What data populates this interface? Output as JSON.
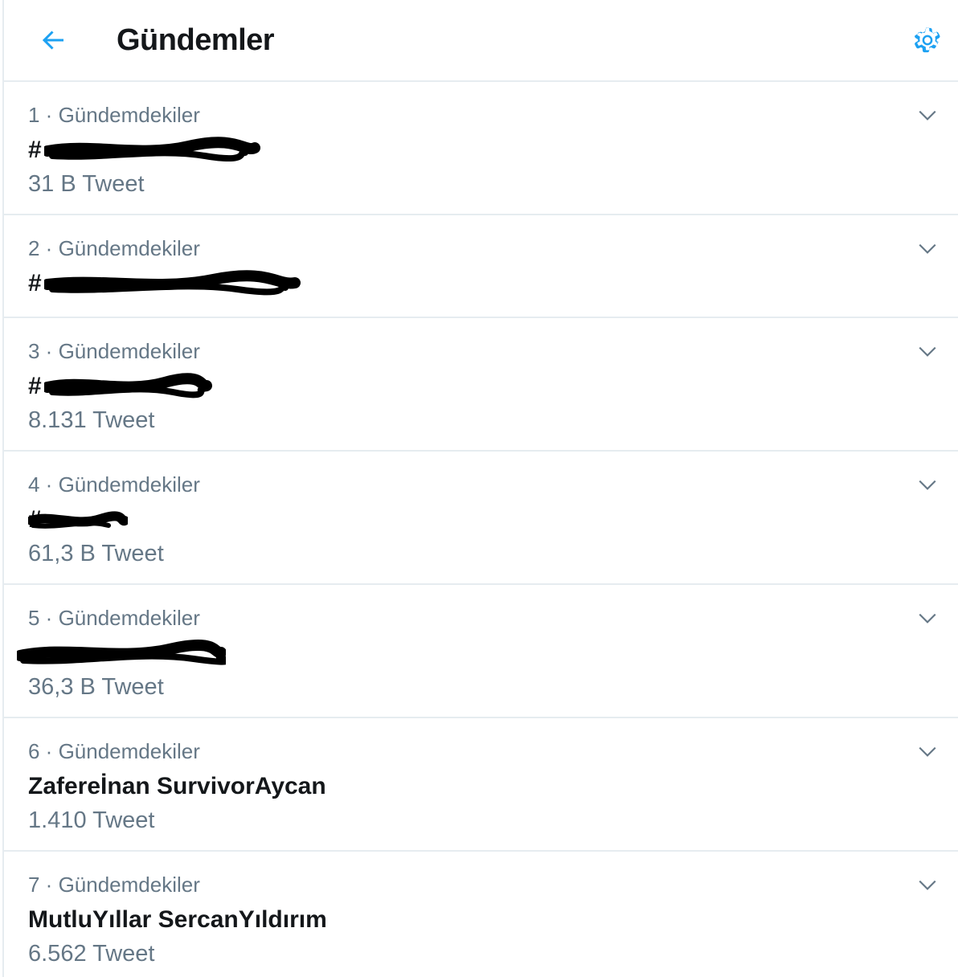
{
  "header": {
    "title": "Gündemler",
    "back_icon": "arrow-left-icon",
    "settings_icon": "gear-icon"
  },
  "colors": {
    "accent": "#1da1f2",
    "text_primary": "#14171a",
    "text_secondary": "#657786",
    "divider": "#e6ecf0",
    "redaction": "#000000"
  },
  "trends": [
    {
      "meta": "1 · Gündemdekiler",
      "name": "#",
      "count": "31 B Tweet",
      "redacted": true
    },
    {
      "meta": "2 · Gündemdekiler",
      "name": "#",
      "count": "",
      "redacted": true
    },
    {
      "meta": "3 · Gündemdekiler",
      "name": "#",
      "count": "8.131 Tweet",
      "redacted": true
    },
    {
      "meta": "4 · Gündemdekiler",
      "name": "#",
      "count": "61,3 B Tweet",
      "redacted": true
    },
    {
      "meta": "5 · Gündemdekiler",
      "name": "",
      "count": "36,3 B Tweet",
      "redacted": true
    },
    {
      "meta": "6 · Gündemdekiler",
      "name": "Zaferеİnan SurvivorAycan",
      "count": "1.410 Tweet",
      "redacted": false
    },
    {
      "meta": "7 · Gündemdekiler",
      "name": "MutluYıllar SercanYıldırım",
      "count": "6.562 Tweet",
      "redacted": false
    }
  ]
}
